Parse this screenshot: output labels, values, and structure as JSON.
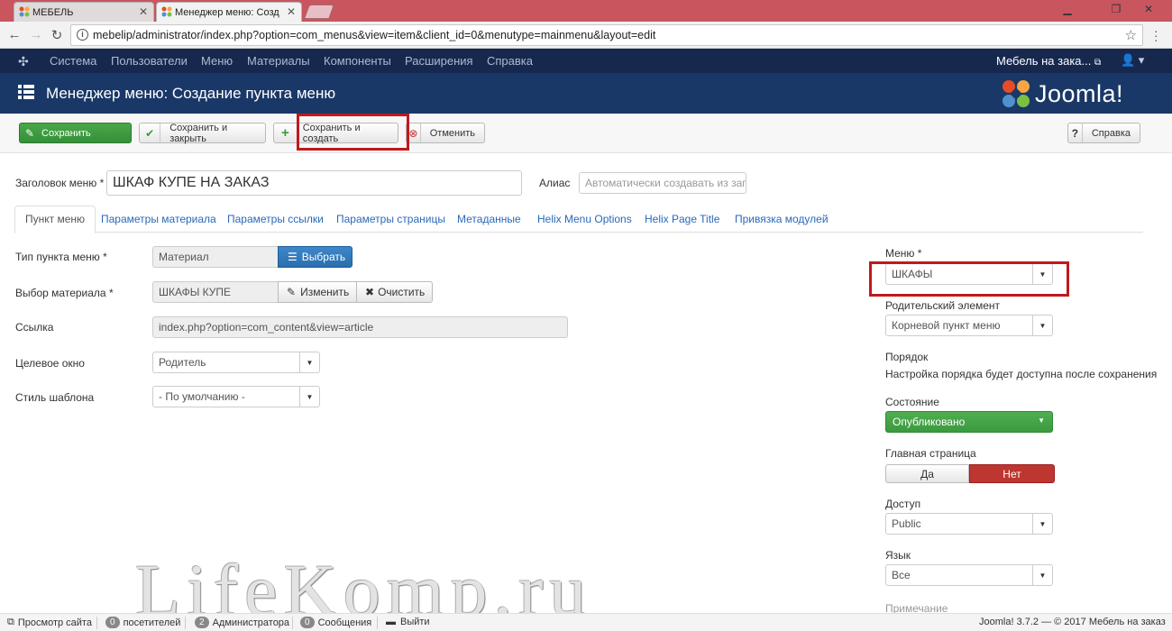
{
  "browser": {
    "tabs": [
      {
        "title": "МЕБЕЛЬ",
        "active": false
      },
      {
        "title": "Менеджер меню: Созд",
        "active": true
      }
    ],
    "url": "mebelip/administrator/index.php?option=com_menus&view=item&client_id=0&menutype=mainmenu&layout=edit"
  },
  "topnav": {
    "items": [
      "Система",
      "Пользователи",
      "Меню",
      "Материалы",
      "Компоненты",
      "Расширения",
      "Справка"
    ],
    "site_link": "Мебель на зака..."
  },
  "header": {
    "title": "Менеджер меню: Создание пункта меню",
    "brand": "Joomla!"
  },
  "toolbar": {
    "save": "Сохранить",
    "save_close": "Сохранить и закрыть",
    "save_new": "Сохранить и создать",
    "cancel": "Отменить",
    "help": "Справка"
  },
  "form": {
    "title_label": "Заголовок меню *",
    "title_value": "ШКАФ КУПЕ НА ЗАКАЗ",
    "alias_label": "Алиас",
    "alias_placeholder": "Автоматически создавать из заголовка"
  },
  "tabs": [
    "Пункт меню",
    "Параметры материала",
    "Параметры ссылки",
    "Параметры страницы",
    "Метаданные",
    "Helix Menu Options",
    "Helix Page Title",
    "Привязка модулей"
  ],
  "details": {
    "type_label": "Тип пункта меню *",
    "type_value": "Материал",
    "select_button": "Выбрать",
    "article_label": "Выбор материала *",
    "article_value": "ШКАФЫ КУПЕ",
    "edit_button": "Изменить",
    "clear_button": "Очистить",
    "link_label": "Ссылка",
    "link_value": "index.php?option=com_content&view=article",
    "target_label": "Целевое окно",
    "target_value": "Родитель",
    "template_label": "Стиль шаблона",
    "template_value": "- По умолчанию -"
  },
  "sidebar": {
    "menu_label": "Меню *",
    "menu_value": "ШКАФЫ",
    "parent_label": "Родительский элемент",
    "parent_value": "Корневой пункт меню",
    "order_label": "Порядок",
    "order_note": "Настройка порядка будет доступна после сохранения",
    "state_label": "Состояние",
    "state_value": "Опубликовано",
    "home_label": "Главная страница",
    "home_yes": "Да",
    "home_no": "Нет",
    "access_label": "Доступ",
    "access_value": "Public",
    "language_label": "Язык",
    "language_value": "Все",
    "note_label": "Примечание"
  },
  "statusbar": {
    "preview": "Просмотр сайта",
    "visitors_count": "0",
    "visitors": "посетителей",
    "admins_count": "2",
    "admins": "Администратора",
    "messages_count": "0",
    "messages": "Сообщения",
    "logout": "Выйти",
    "version": "Joomla! 3.7.2 — © 2017 Мебель на заказ"
  },
  "watermark": "LifeKomp.ru",
  "colors": {
    "nav_bg": "#17284f",
    "header_bg": "#1a3867",
    "highlight": "#c0191d",
    "green": "#3b9a3e",
    "red": "#bd362f",
    "blue": "#2a6ead"
  }
}
